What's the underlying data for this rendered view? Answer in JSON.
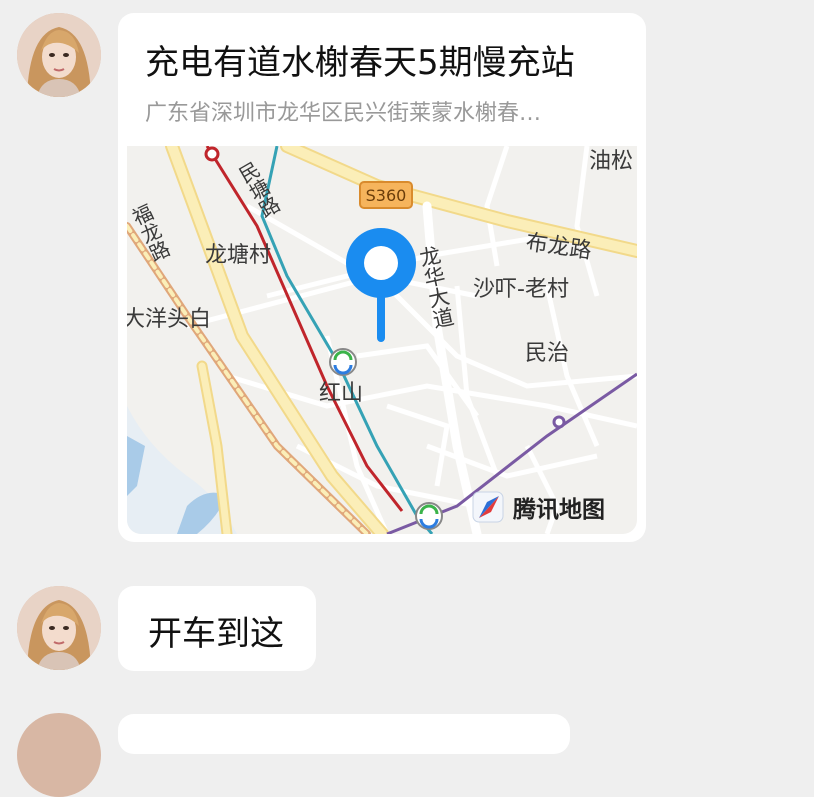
{
  "messages": [
    {
      "type": "location",
      "title": "充电有道水榭春天5期慢充站",
      "address": "广东省深圳市龙华区民兴街莱蒙水榭春…",
      "map": {
        "labels": {
          "youson": "油松",
          "minsheng_road": "民塘路",
          "s360": "S360",
          "bulong_road": "布龙路",
          "fulong_road": "福龙路",
          "longtang_village": "龙塘村",
          "longhua_avenue": "龙华大道",
          "shaxia_village": "沙吓-老村",
          "dayangtoubai": "大洋头白",
          "minzhi": "民治",
          "hongshan": "红山"
        },
        "provider": "腾讯地图"
      }
    },
    {
      "type": "text",
      "text": "开车到这"
    }
  ],
  "colors": {
    "background": "#efefef",
    "bubble": "#ffffff",
    "pin": "#1a8cf0",
    "metro_red": "#c0252b",
    "metro_teal": "#35a2b5",
    "metro_purple": "#7a5aa3"
  }
}
